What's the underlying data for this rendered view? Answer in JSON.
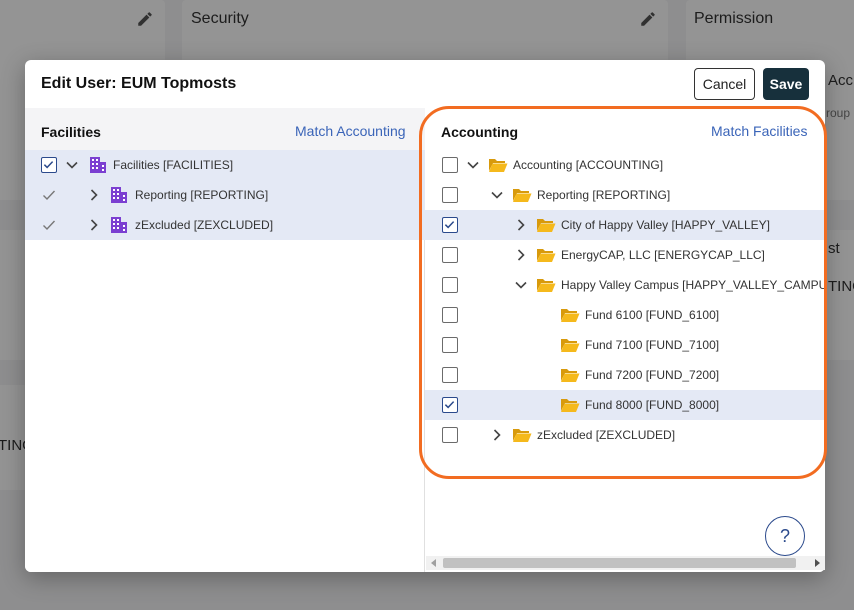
{
  "background": {
    "security_title": "Security",
    "permission_title": "Permission",
    "frag_acc": "Acc",
    "frag_roup": "roup",
    "frag_st": "st",
    "frag_ting": "TING",
    "frag_ting_left": "TING"
  },
  "modal": {
    "title": "Edit User: EUM Topmosts",
    "cancel_label": "Cancel",
    "save_label": "Save",
    "help_label": "?"
  },
  "facilities": {
    "title": "Facilities",
    "match_link": "Match Accounting",
    "rows": [
      {
        "label": "Facilities [FACILITIES]"
      },
      {
        "label": "Reporting [REPORTING]"
      },
      {
        "label": "zExcluded [ZEXCLUDED]"
      }
    ]
  },
  "accounting": {
    "title": "Accounting",
    "match_link": "Match Facilities",
    "rows": [
      {
        "label": "Accounting [ACCOUNTING]"
      },
      {
        "label": "Reporting [REPORTING]"
      },
      {
        "label": "City of Happy Valley [HAPPY_VALLEY]"
      },
      {
        "label": "EnergyCAP, LLC [ENERGYCAP_LLC]"
      },
      {
        "label": "Happy Valley Campus [HAPPY_VALLEY_CAMPUS]"
      },
      {
        "label": "Fund 6100 [FUND_6100]"
      },
      {
        "label": "Fund 7100 [FUND_7100]"
      },
      {
        "label": "Fund 7200 [FUND_7200]"
      },
      {
        "label": "Fund 8000 [FUND_8000]"
      },
      {
        "label": "zExcluded [ZEXCLUDED]"
      }
    ]
  },
  "colors": {
    "accent": "#2b4a8c",
    "save_bg": "#17303c",
    "highlight": "#f26c21",
    "folder": "#f5b91c",
    "building": "#7b3fd1",
    "selected_row": "#e4e9f5"
  },
  "icons": [
    "pencil-icon",
    "chevron-down-icon",
    "chevron-right-icon",
    "building-icon",
    "folder-open-icon",
    "check-icon"
  ]
}
